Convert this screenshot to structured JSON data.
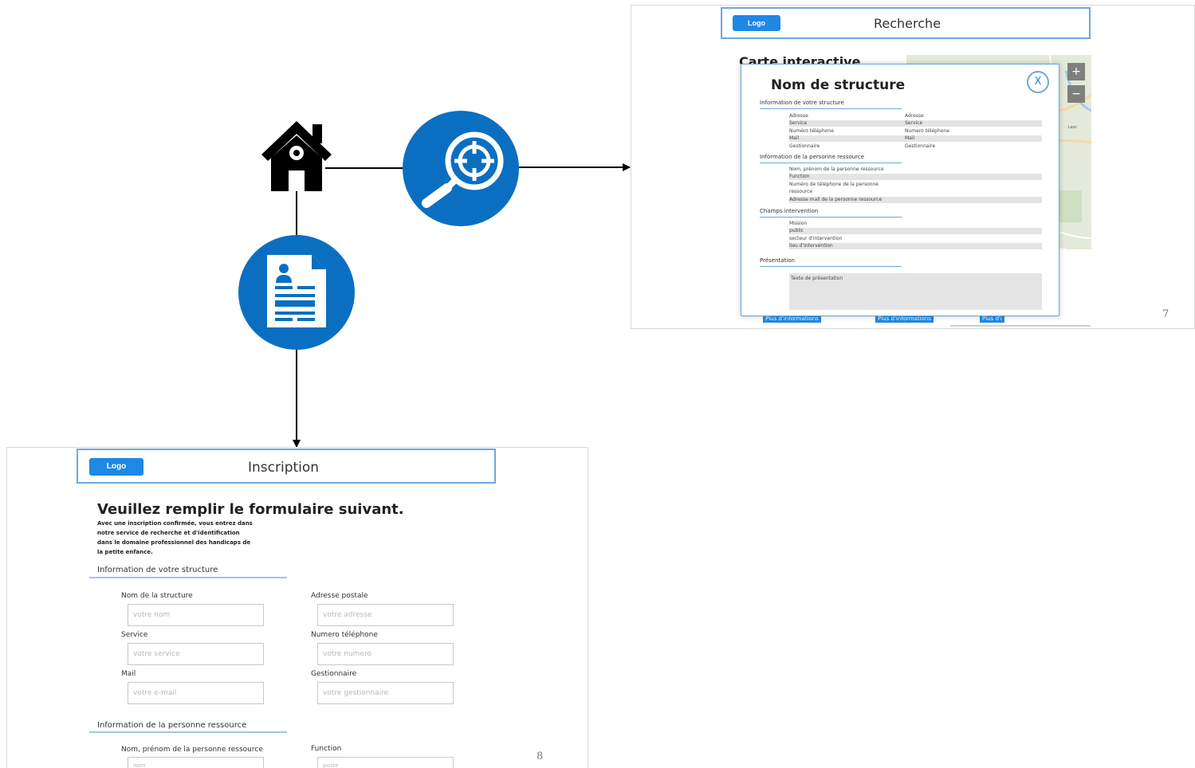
{
  "flow": {
    "icons": [
      "home-icon",
      "search-target-icon",
      "registration-form-icon"
    ]
  },
  "search_slide": {
    "logo": "Logo",
    "header_title": "Recherche",
    "map_title": "Carte interactive",
    "zoom_in": "+",
    "zoom_out": "−",
    "map_place": "Lesc",
    "page_number": "7",
    "more_buttons": [
      "Plus d'informations",
      "Plus d'informations",
      "Plus d'i"
    ],
    "modal": {
      "title": "Nom de structure",
      "close": "X",
      "sections": [
        "Information de votre structure",
        "Information de la personne ressource",
        "Champs intervention",
        "Présentation"
      ],
      "structure_rows": [
        {
          "left": "Adresse",
          "right": "Adresse"
        },
        {
          "left": "Service",
          "right": "Service"
        },
        {
          "left": "Numéro téléphone",
          "right": "Numero téléphone"
        },
        {
          "left": "Mail",
          "right": "Mail"
        },
        {
          "left": "Gestionnaire",
          "right": "Gestionnaire"
        }
      ],
      "person_rows": [
        "Nom, prénom de la personne ressource",
        "Function",
        "Numéro de téléphone de la personne",
        "ressource",
        "Adresse mail de la personne ressource"
      ],
      "intervention_rows": [
        "Mission",
        "public",
        "secteur d'intervention",
        "lieu d'intervention"
      ],
      "presentation_text": "Texte de présentation"
    }
  },
  "inscription_slide": {
    "logo": "Logo",
    "header_title": "Inscription",
    "title": "Veuillez remplir le formulaire suivant.",
    "intro_lines": [
      "Avec une inscription confirmée, vous entrez dans",
      "notre service de recherche et d'identification",
      "dans le domaine professionnel des handicaps de",
      "la petite enfance."
    ],
    "sections": [
      "Information de votre structure",
      "Information de la personne ressource"
    ],
    "fields": [
      {
        "label": "Nom de la structure",
        "placeholder": "votre nom"
      },
      {
        "label": "Adresse postale",
        "placeholder": "votre adresse"
      },
      {
        "label": "Service",
        "placeholder": "votre service"
      },
      {
        "label": "Numero téléphone",
        "placeholder": "votre numero"
      },
      {
        "label": "Mail",
        "placeholder": "votre e-mail"
      },
      {
        "label": "Gestionnaire",
        "placeholder": "votre gestionnaire"
      },
      {
        "label": "Nom, prénom de la personne ressource",
        "placeholder": "nom"
      },
      {
        "label": "Function",
        "placeholder": "poste"
      }
    ],
    "page_number": "8"
  }
}
